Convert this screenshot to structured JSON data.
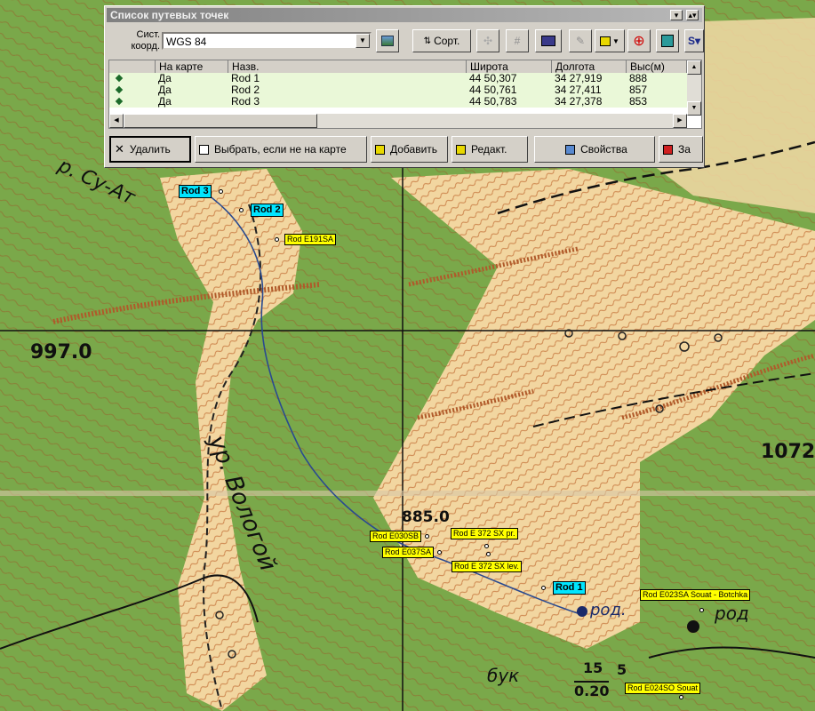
{
  "window": {
    "title": "Список путевых точек",
    "controls": [
      "▾",
      "▴▾",
      "✕"
    ],
    "coord_label_1": "Сист.",
    "coord_label_2": "коорд.",
    "coord_system": "WGS 84",
    "sort_label": "Сорт.",
    "columns": [
      "На карте",
      "Назв.",
      "Широта",
      "Долгота",
      "Выс(м)"
    ],
    "rows": [
      {
        "on_map": "Да",
        "name": "Rod 1",
        "lat": "44 50,307",
        "lon": "34 27,919",
        "alt": "888"
      },
      {
        "on_map": "Да",
        "name": "Rod 2",
        "lat": "44 50,761",
        "lon": "34 27,411",
        "alt": "857"
      },
      {
        "on_map": "Да",
        "name": "Rod 3",
        "lat": "44 50,783",
        "lon": "34 27,378",
        "alt": "853"
      }
    ],
    "buttons": {
      "delete": "Удалить",
      "select_off_map": "Выбрать, если не на карте",
      "add": "Добавить",
      "edit": "Редакт.",
      "properties": "Свойства",
      "close": "За"
    }
  },
  "map": {
    "elevations": [
      "997.0",
      "885.0",
      "1072"
    ],
    "place_label": "ур. Вологой",
    "river_label": "р. Су-Ат",
    "spring_label_1": "род.",
    "spring_label_2": "род",
    "forest_label": "бук",
    "forest_numer": "15",
    "forest_denom": "0.20",
    "forest_extra": "5"
  },
  "waypoints": [
    {
      "label": "Rod 3",
      "style": "cyan"
    },
    {
      "label": "Rod 2",
      "style": "cyan"
    },
    {
      "label": "Rod E191SA",
      "style": "yellow"
    },
    {
      "label": "Rod E030SB",
      "style": "yellow"
    },
    {
      "label": "Rod E 372 SX pr.",
      "style": "yellow"
    },
    {
      "label": "Rod E037SA",
      "style": "yellow"
    },
    {
      "label": "Rod E 372 SX lev.",
      "style": "yellow"
    },
    {
      "label": "Rod 1",
      "style": "cyan"
    },
    {
      "label": "Rod E023SA Souat - Botchka",
      "style": "yellow"
    },
    {
      "label": "Rod E024SO Souat",
      "style": "yellow"
    }
  ],
  "colors": {
    "forest": "#7aa84a",
    "clearing": "#f2d6a0",
    "contour": "#b05a2a",
    "stream": "#2a4a90",
    "highlight": "#00e5ff",
    "label_bg": "#ffff00"
  }
}
